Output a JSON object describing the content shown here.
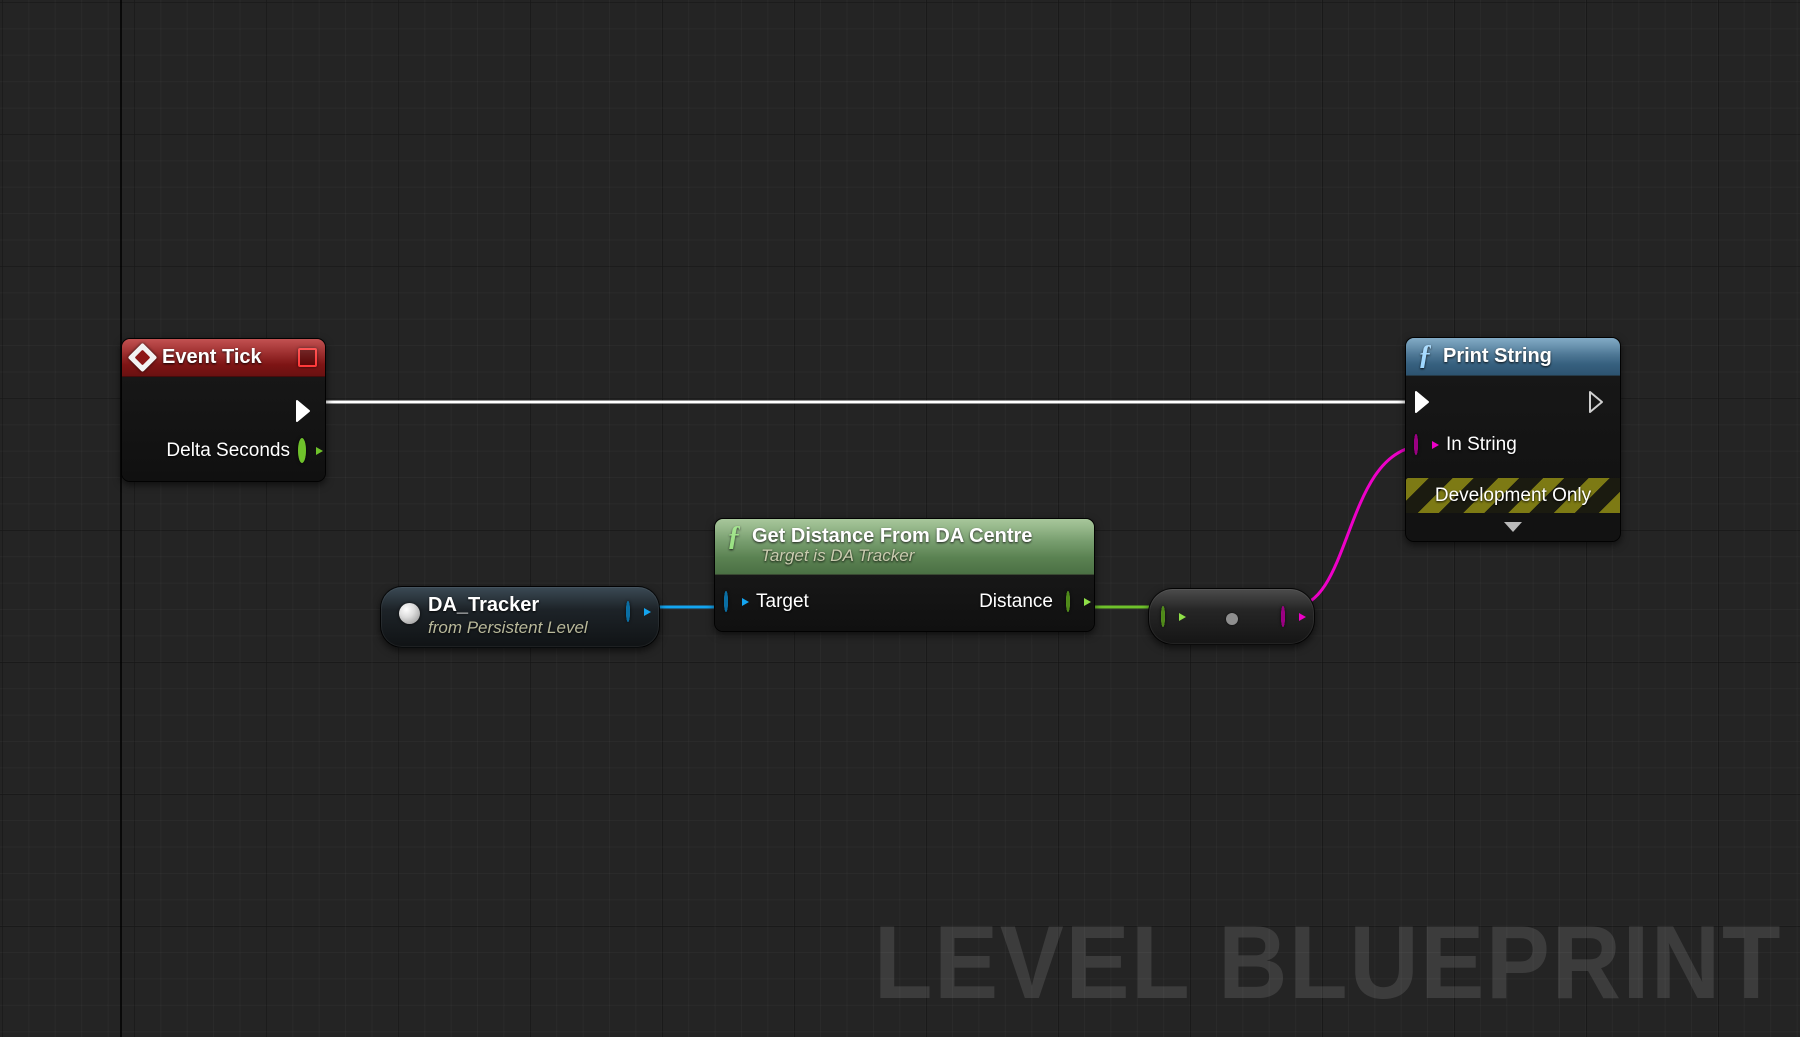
{
  "editor": {
    "watermark": "LEVEL BLUEPRINT",
    "background_color": "#242424",
    "grid_minor_color": "#2a2a2a",
    "grid_major_color": "#121212"
  },
  "nodes": {
    "event_tick": {
      "title": "Event Tick",
      "icon": "event-diamond-icon",
      "header_color": "#8d1717",
      "breakpoint_icon": "stop-square-icon",
      "exec_out_label": "",
      "pins": [
        {
          "name": "Delta Seconds",
          "type": "float",
          "direction": "output",
          "color": "#6fc22b"
        }
      ]
    },
    "da_tracker": {
      "title": "DA_Tracker",
      "subtitle": "from Persistent Level",
      "icon": "object-sphere-icon",
      "output_pin": {
        "type": "object",
        "color": "#14a5f0"
      }
    },
    "get_distance": {
      "title": "Get Distance From DA Centre",
      "subtitle": "Target is DA Tracker",
      "icon": "function-f-icon",
      "header_color": "#6a9460",
      "pins": [
        {
          "name": "Target",
          "type": "object",
          "direction": "input",
          "color": "#14a5f0"
        },
        {
          "name": "Distance",
          "type": "float",
          "direction": "output",
          "color": "#8fe048"
        }
      ]
    },
    "convert_node": {
      "title": "",
      "input_pin": {
        "type": "float",
        "color": "#8fe048"
      },
      "output_pin": {
        "type": "string",
        "color": "#ee00c8"
      },
      "center_dot_color": "#8e8e8e"
    },
    "print_string": {
      "title": "Print String",
      "icon": "function-f-icon",
      "header_color": "#3f6c8c",
      "pins": [
        {
          "name": "In String",
          "type": "string",
          "direction": "input",
          "color": "#ee00c8"
        }
      ],
      "dev_only_label": "Development Only",
      "expander_icon": "chevron-down-icon"
    }
  },
  "wires": [
    {
      "from": "event_tick.exec_out",
      "to": "print_string.exec_in",
      "color": "#ffffff",
      "type": "exec"
    },
    {
      "from": "da_tracker.out",
      "to": "get_distance.target",
      "color": "#14a5f0",
      "type": "object"
    },
    {
      "from": "get_distance.distance",
      "to": "convert_node.in",
      "color": "#6fc22b",
      "type": "float"
    },
    {
      "from": "convert_node.out",
      "to": "print_string.in_string",
      "color": "#ee00c8",
      "type": "string"
    }
  ]
}
